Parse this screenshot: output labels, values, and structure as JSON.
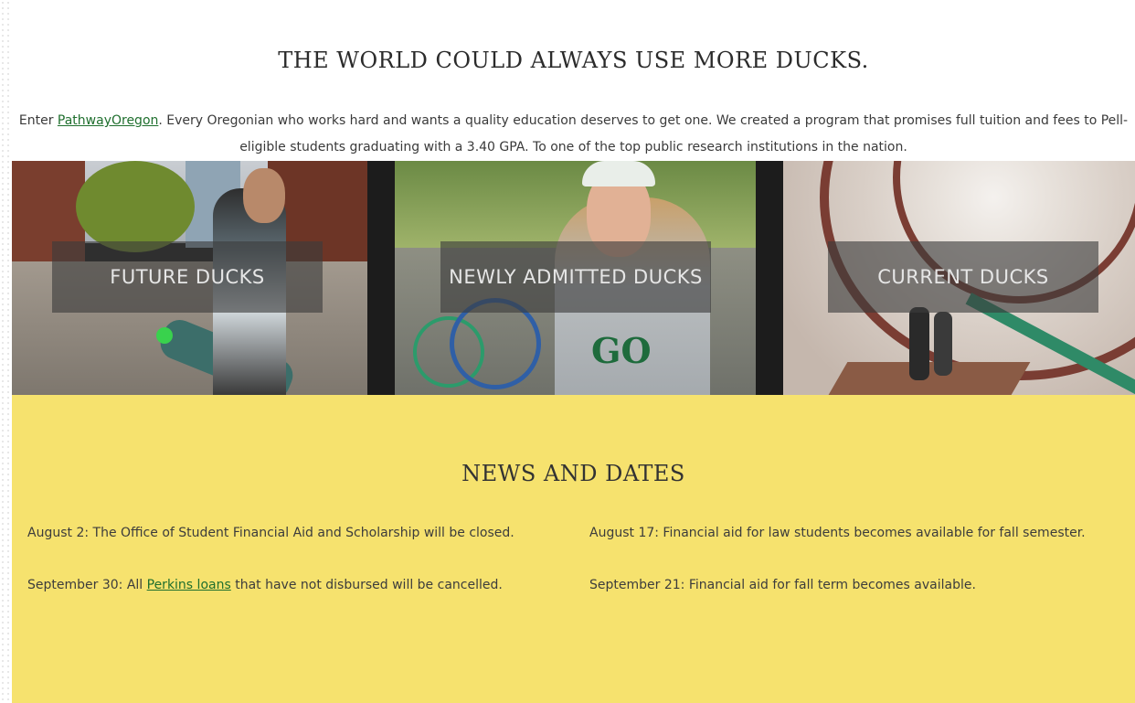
{
  "intro": {
    "headline": "THE WORLD COULD ALWAYS USE MORE DUCKS.",
    "text_before": "Enter ",
    "link_text": "PathwayOregon",
    "text_after": ". Every Oregonian who works hard and wants a quality education deserves to get one. We created a program that promises full tuition and fees to Pell-eligible students graduating with a 3.40 GPA. To one of the top public research institutions in the nation."
  },
  "tiles": [
    {
      "label": "FUTURE DUCKS"
    },
    {
      "label": "NEWLY ADMITTED DUCKS"
    },
    {
      "label": "CURRENT DUCKS"
    }
  ],
  "news": {
    "title": "NEWS AND DATES",
    "items": [
      {
        "text": "August 2: The Office of Student Financial Aid and Scholarship will be closed."
      },
      {
        "text": "August 17: Financial aid for law students becomes available for fall semester."
      },
      {
        "text_before": "September 30: All ",
        "link_text": "Perkins loans",
        "text_after": " that have not disbursed will be cancelled."
      },
      {
        "text": "September 21: Financial aid for fall term becomes available."
      }
    ]
  },
  "colors": {
    "news_background": "#f6e26e",
    "link": "#1f6f2e",
    "tile_label_background": "rgba(60,60,60,0.62)"
  }
}
